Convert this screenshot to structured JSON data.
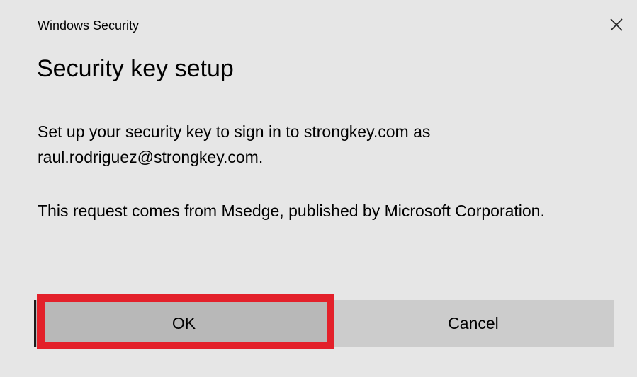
{
  "window": {
    "title": "Windows Security",
    "close_icon": "close-icon"
  },
  "dialog": {
    "heading": "Security key setup",
    "message_1": "Set up your security key to sign in to strongkey.com as raul.rodriguez@strongkey.com.",
    "message_2": "This request comes from Msedge, published by Microsoft Corporation."
  },
  "buttons": {
    "ok_label": "OK",
    "cancel_label": "Cancel"
  },
  "colors": {
    "background": "#e6e6e6",
    "button": "#cccccc",
    "highlight": "#e3202a"
  }
}
